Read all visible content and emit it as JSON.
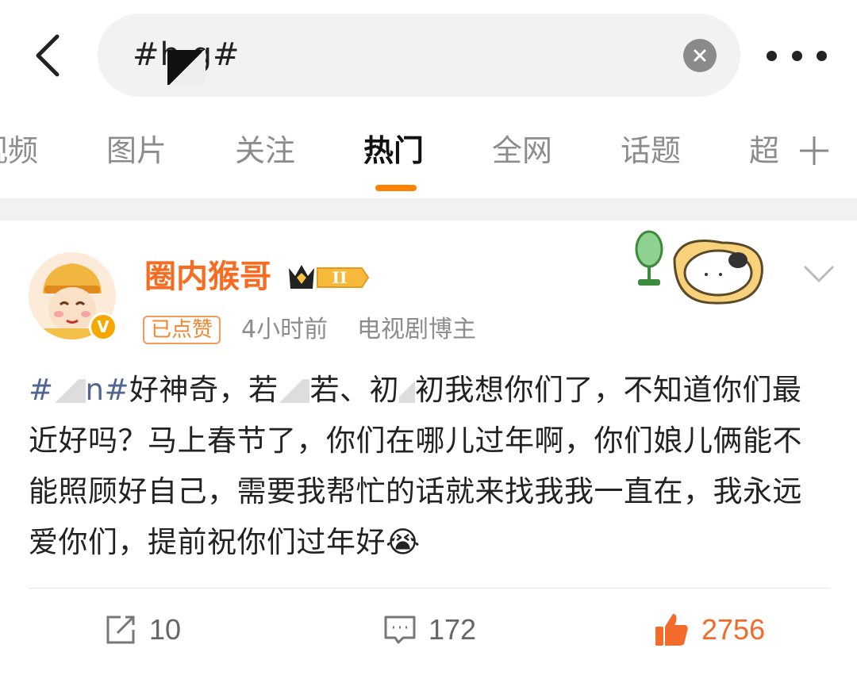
{
  "search": {
    "query": "#h  g#",
    "clear_label": "×"
  },
  "tabs": [
    {
      "label": "视频"
    },
    {
      "label": "图片"
    },
    {
      "label": "关注"
    },
    {
      "label": "热门"
    },
    {
      "label": "全网"
    },
    {
      "label": "话题"
    },
    {
      "label": "超"
    }
  ],
  "active_tab": "热门",
  "post": {
    "username": "圈内猴哥",
    "vip_level": "II",
    "liked_tag": "已点赞",
    "time": "4小时前",
    "source": "电视剧博主",
    "verified_badge": "V",
    "hashtag_start": "#",
    "hashtag_end": "n#",
    "text_1": "好神奇，",
    "text_2": "若",
    "text_3": "若、",
    "text_4": "初",
    "text_5": "初我想你们了，不知道你们最近好吗？马上春节了，你们在哪儿过年啊，你们娘儿俩能不能照顾好自己，需要我帮忙的话就来找我我一直在，我永远爱你们，提前祝你们过年好",
    "emoji": "😭"
  },
  "actions": {
    "repost_count": "10",
    "comment_count": "172",
    "like_count": "2756"
  },
  "colors": {
    "accent": "#ff8200",
    "username": "#f86b20",
    "hashtag": "#516791",
    "like": "#f26b2a"
  }
}
